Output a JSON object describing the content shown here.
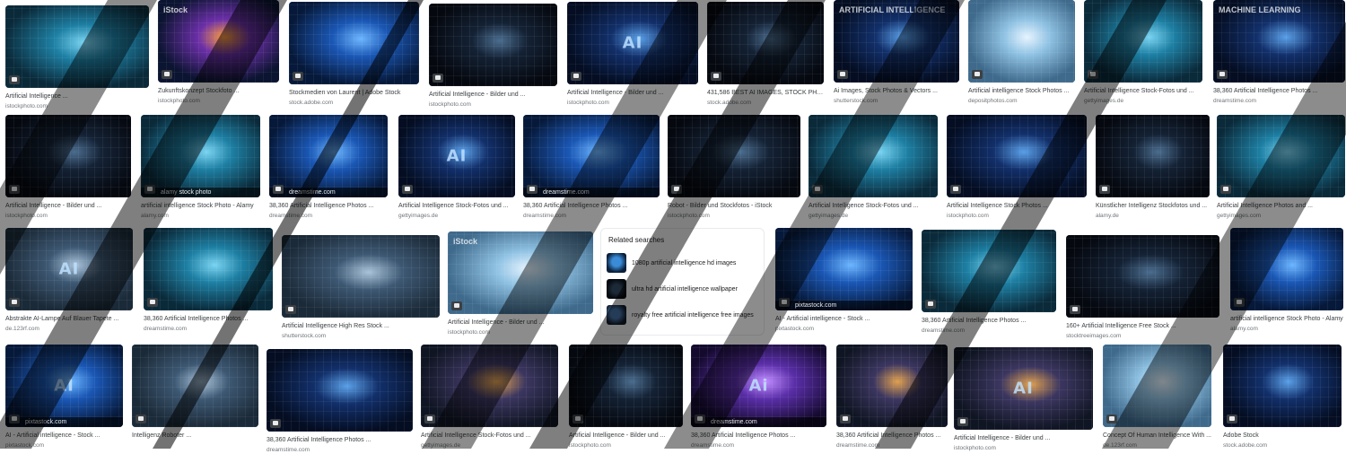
{
  "tiles": [
    {
      "caption": "Artificial Intelligence ...",
      "source": "istockphoto.com",
      "motif": "",
      "wm": "",
      "wmtop": "",
      "hue": "teal"
    },
    {
      "caption": "Zukunftskonzept Stockfoto ...",
      "source": "istockphoto.com",
      "motif": "",
      "wm": "",
      "wmtop": "iStock",
      "hue": "brain"
    },
    {
      "caption": "Stockmedien von Laurent | Adobe Stock",
      "source": "stock.adobe.com",
      "motif": "",
      "wm": "",
      "wmtop": "",
      "hue": "blue"
    },
    {
      "caption": "Artificial Intelligence - Bilder und ...",
      "source": "istockphoto.com",
      "motif": "",
      "wm": "",
      "wmtop": "",
      "hue": "dark"
    },
    {
      "caption": "Artificial Intelligence - Bilder und ...",
      "source": "istockphoto.com",
      "motif": "AI",
      "wm": "",
      "wmtop": "",
      "hue": "navy"
    },
    {
      "caption": "431,586 BEST AI IMAGES, STOCK PHOTO...",
      "source": "stock.adobe.com",
      "motif": "",
      "wm": "",
      "wmtop": "",
      "hue": "dark"
    },
    {
      "caption": "Ai Images, Stock Photos & Vectors ...",
      "source": "shutterstock.com",
      "motif": "",
      "wm": "",
      "wmtop": "ARTIFICIAL INTELLIGENCE",
      "hue": "navy"
    },
    {
      "caption": "Artificial intelligence Stock Photos ...",
      "source": "depositphotos.com",
      "motif": "",
      "wm": "",
      "wmtop": "",
      "hue": "light"
    },
    {
      "caption": "Artificial Intelligence Stock-Fotos und ...",
      "source": "gettyimages.de",
      "motif": "",
      "wm": "",
      "wmtop": "",
      "hue": "teal"
    },
    {
      "caption": "38,360 Artificial Intelligence Photos ...",
      "source": "dreamstime.com",
      "motif": "",
      "wm": "",
      "wmtop": "MACHINE LEARNING",
      "hue": "navy"
    },
    {
      "caption": "Artificial Intelligence - Bilder und ...",
      "source": "istockphoto.com",
      "motif": "",
      "wm": "",
      "wmtop": "",
      "hue": "dark"
    },
    {
      "caption": "artificial intelligence Stock Photo - Alamy",
      "source": "alamy.com",
      "motif": "",
      "wm": "alamy stock photo",
      "wmtop": "",
      "hue": "teal"
    },
    {
      "caption": "38,360 Artificial Intelligence Photos ...",
      "source": "dreamstime.com",
      "motif": "",
      "wm": "dreamstime.com",
      "wmtop": "",
      "hue": "blue"
    },
    {
      "caption": "Artificial Intelligence Stock-Fotos und ...",
      "source": "gettyimages.de",
      "motif": "AI",
      "wm": "",
      "wmtop": "",
      "hue": "navy"
    },
    {
      "caption": "38,360 Artificial Intelligence Photos ...",
      "source": "dreamstime.com",
      "motif": "",
      "wm": "dreamstime.com",
      "wmtop": "",
      "hue": "blue"
    },
    {
      "caption": "Robot - Bilder und Stockfotos - iStock",
      "source": "istockphoto.com",
      "motif": "",
      "wm": "",
      "wmtop": "",
      "hue": "dark"
    },
    {
      "caption": "Artificial Intelligence Stock-Fotos und ...",
      "source": "gettyimages.de",
      "motif": "",
      "wm": "",
      "wmtop": "",
      "hue": "teal"
    },
    {
      "caption": "Artificial Intelligence Stock Photos ...",
      "source": "istockphoto.com",
      "motif": "",
      "wm": "",
      "wmtop": "",
      "hue": "navy"
    },
    {
      "caption": "Künstlicher Intelligenz Stockfotos und ...",
      "source": "alamy.de",
      "motif": "",
      "wm": "",
      "wmtop": "",
      "hue": "dark"
    },
    {
      "caption": "Artificial Intelligence Photos and ...",
      "source": "gettyimages.com",
      "motif": "",
      "wm": "",
      "wmtop": "",
      "hue": "teal"
    },
    {
      "caption": "Abstrakte AI-Lampe Auf Blauer Tapete ...",
      "source": "de.123rf.com",
      "motif": "AI",
      "wm": "",
      "wmtop": "",
      "hue": "slate"
    },
    {
      "caption": "38,360 Artificial Intelligence Photos ...",
      "source": "dreamstime.com",
      "motif": "",
      "wm": "",
      "wmtop": "",
      "hue": "teal"
    },
    {
      "caption": "Artificial Intelligence High Res Stock ...",
      "source": "shutterstock.com",
      "motif": "",
      "wm": "",
      "wmtop": "",
      "hue": "slate"
    },
    {
      "caption": "Artificial Intelligence - Bilder und ...",
      "source": "istockphoto.com",
      "motif": "",
      "wm": "",
      "wmtop": "iStock",
      "hue": "light"
    },
    {
      "caption": "AI - Artificial intelligence - Stock ...",
      "source": "pixtastock.com",
      "motif": "",
      "wm": "pixtastock.com",
      "wmtop": "",
      "hue": "blue"
    },
    {
      "caption": "38,360 Artificial Intelligence Photos ...",
      "source": "dreamstime.com",
      "motif": "",
      "wm": "",
      "wmtop": "",
      "hue": "teal"
    },
    {
      "caption": "160+ Artificial Intelligence Free Stock ...",
      "source": "stocktreeimages.com",
      "motif": "",
      "wm": "",
      "wmtop": "",
      "hue": "dark"
    },
    {
      "caption": "artificial intelligence Stock Photo - Alamy",
      "source": "alamy.com",
      "motif": "",
      "wm": "",
      "wmtop": "",
      "hue": "blue"
    },
    {
      "caption": "AI - Artificial intelligence - Stock ...",
      "source": "pixtastock.com",
      "motif": "AI",
      "wm": "pixtastock.com",
      "wmtop": "",
      "hue": "blue"
    },
    {
      "caption": "Intelligenz Roboter ...",
      "source": "",
      "motif": "",
      "wm": "",
      "wmtop": "",
      "hue": "slate"
    },
    {
      "caption": "38,360 Artificial Intelligence Photos ...",
      "source": "dreamstime.com",
      "motif": "",
      "wm": "",
      "wmtop": "",
      "hue": "navy"
    },
    {
      "caption": "Artificial Intelligence Stock-Fotos und ...",
      "source": "gettyimages.de",
      "motif": "",
      "wm": "",
      "wmtop": "",
      "hue": "warm"
    },
    {
      "caption": "Artificial Intelligence - Bilder und ...",
      "source": "istockphoto.com",
      "motif": "",
      "wm": "",
      "wmtop": "",
      "hue": "dark"
    },
    {
      "caption": "38,360 Artificial Intelligence Photos ...",
      "source": "dreamstime.com",
      "motif": "Ai",
      "wm": "dreamstime.com",
      "wmtop": "",
      "hue": "purple"
    },
    {
      "caption": "38,360 Artificial Intelligence Photos ...",
      "source": "dreamstime.com",
      "motif": "",
      "wm": "",
      "wmtop": "",
      "hue": "warm"
    },
    {
      "caption": "Artificial Intelligence - Bilder und ...",
      "source": "istockphoto.com",
      "motif": "AI",
      "wm": "",
      "wmtop": "",
      "hue": "warm"
    },
    {
      "caption": "Concept Of Human Intelligence With ...",
      "source": "de.123rf.com",
      "motif": "",
      "wm": "",
      "wmtop": "",
      "hue": "light"
    },
    {
      "caption": "Adobe Stock",
      "source": "stock.adobe.com",
      "motif": "",
      "wm": "",
      "wmtop": "",
      "hue": "navy"
    }
  ],
  "related": {
    "title": "Related searches",
    "items": [
      {
        "label": "1080p artificial intelligence hd images"
      },
      {
        "label": "ultra hd artificial intelligence wallpaper"
      },
      {
        "label": "royalty free artificial intelligence free images"
      }
    ]
  },
  "colors": {
    "overlay": "#000000",
    "caption": "#3c4043",
    "source": "#70757a"
  }
}
